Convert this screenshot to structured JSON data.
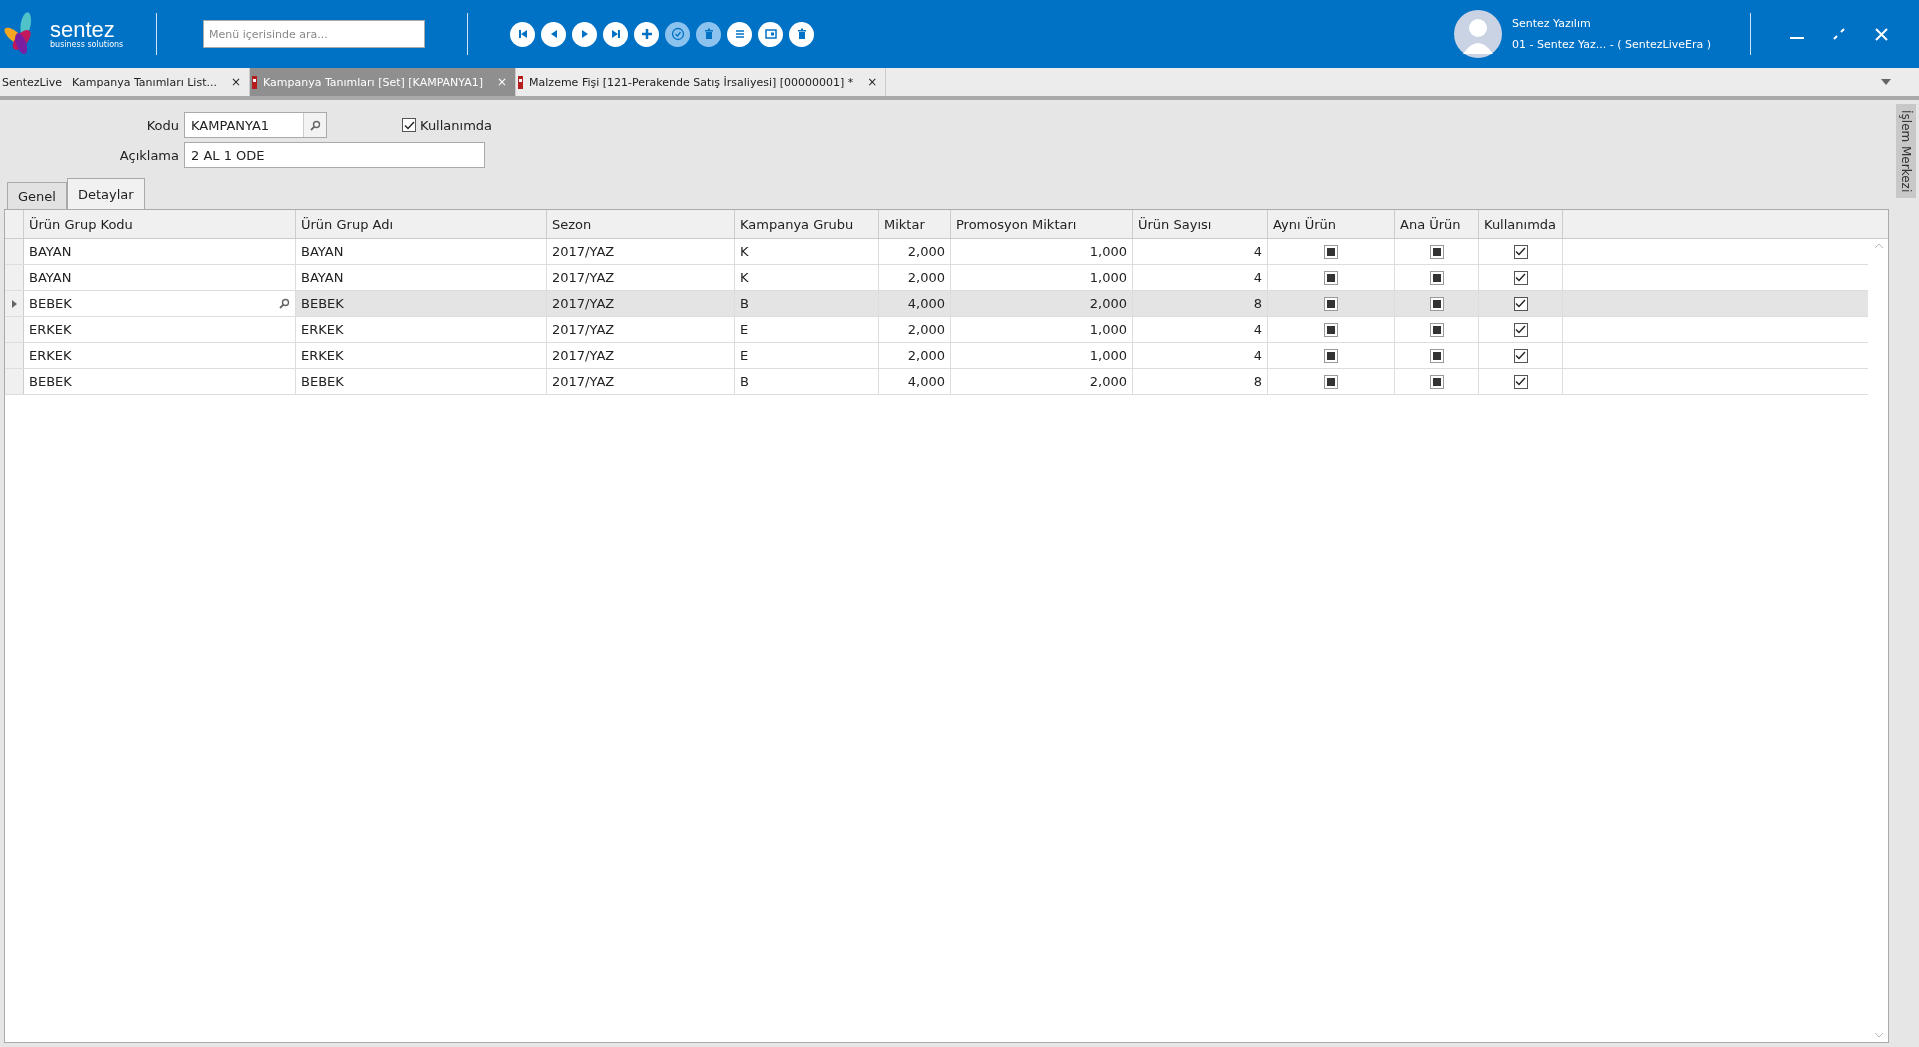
{
  "header": {
    "logo": {
      "name": "sentez",
      "tagline": "business solutions"
    },
    "search": {
      "placeholder": "Menü içerisinde ara..."
    },
    "toolbar": [
      {
        "kind": "first",
        "disabled": false
      },
      {
        "kind": "previous",
        "disabled": false
      },
      {
        "kind": "next",
        "disabled": false
      },
      {
        "kind": "last",
        "disabled": false
      },
      {
        "kind": "add",
        "disabled": false
      },
      {
        "kind": "approve",
        "disabled": true
      },
      {
        "kind": "delete",
        "disabled": true
      },
      {
        "kind": "list",
        "disabled": false
      },
      {
        "kind": "card",
        "disabled": false
      },
      {
        "kind": "delete",
        "disabled": false
      }
    ],
    "user": {
      "name": "Sentez Yazılım",
      "company": "01 - Sentez Yaz... - ( SentezLiveEra )"
    }
  },
  "document_tabs": [
    {
      "prefix": "SentezLive",
      "label": "Kampanya Tanımları List...",
      "close": "×",
      "marked": false,
      "selected": false
    },
    {
      "label": "Kampanya Tanımları  [Set] [KAMPANYA1]",
      "close": "×",
      "marked": true,
      "selected": true
    },
    {
      "label": "Malzeme Fişi [121-Perakende Satış İrsaliyesi]  [00000001]  *",
      "close": "×",
      "marked": true,
      "selected": false
    }
  ],
  "side_panel": {
    "title": "İşlem Merkezi"
  },
  "form": {
    "code_label": "Kodu",
    "code": "KAMPANYA1",
    "in_use_label": "Kullanımda",
    "in_use": true,
    "description_label": "Açıklama",
    "description": "2 AL 1 ODE"
  },
  "tabs": [
    {
      "label": "Genel",
      "selected": false
    },
    {
      "label": "Detaylar",
      "selected": true
    }
  ],
  "table": {
    "columns": [
      {
        "label": "Ürün Grup Kodu",
        "kind": "text"
      },
      {
        "label": "Ürün Grup Adı",
        "kind": "text"
      },
      {
        "label": "Sezon",
        "kind": "text"
      },
      {
        "label": "Kampanya Grubu",
        "kind": "text"
      },
      {
        "label": "Miktar",
        "kind": "number"
      },
      {
        "label": "Promosyon Miktarı",
        "kind": "number"
      },
      {
        "label": "Ürün Sayısı",
        "kind": "number"
      },
      {
        "label": "Aynı Ürün",
        "kind": "check"
      },
      {
        "label": "Ana Ürün",
        "kind": "check"
      },
      {
        "label": "Kullanımda",
        "kind": "check"
      }
    ],
    "rows": [
      {
        "selected": false,
        "cells": [
          "BAYAN",
          "BAYAN",
          "2017/YAZ",
          "K",
          "2,000",
          "1,000",
          "4"
        ],
        "flags": [
          {
            "indeterminate": true
          },
          {
            "indeterminate": true
          },
          {
            "checked": true
          }
        ]
      },
      {
        "selected": false,
        "cells": [
          "BAYAN",
          "BAYAN",
          "2017/YAZ",
          "K",
          "2,000",
          "1,000",
          "4"
        ],
        "flags": [
          {
            "indeterminate": true
          },
          {
            "indeterminate": true
          },
          {
            "checked": true
          }
        ]
      },
      {
        "selected": true,
        "cells": [
          "BEBEK",
          "BEBEK",
          "2017/YAZ",
          "B",
          "4,000",
          "2,000",
          "8"
        ],
        "flags": [
          {
            "indeterminate": true
          },
          {
            "indeterminate": true
          },
          {
            "checked": true
          }
        ]
      },
      {
        "selected": false,
        "cells": [
          "ERKEK",
          "ERKEK",
          "2017/YAZ",
          "E",
          "2,000",
          "1,000",
          "4"
        ],
        "flags": [
          {
            "indeterminate": true
          },
          {
            "indeterminate": true
          },
          {
            "checked": true
          }
        ]
      },
      {
        "selected": false,
        "cells": [
          "ERKEK",
          "ERKEK",
          "2017/YAZ",
          "E",
          "2,000",
          "1,000",
          "4"
        ],
        "flags": [
          {
            "indeterminate": true
          },
          {
            "indeterminate": true
          },
          {
            "checked": true
          }
        ]
      },
      {
        "selected": false,
        "cells": [
          "BEBEK",
          "BEBEK",
          "2017/YAZ",
          "B",
          "4,000",
          "2,000",
          "8"
        ],
        "flags": [
          {
            "indeterminate": true
          },
          {
            "indeterminate": true
          },
          {
            "checked": true
          }
        ]
      }
    ]
  }
}
